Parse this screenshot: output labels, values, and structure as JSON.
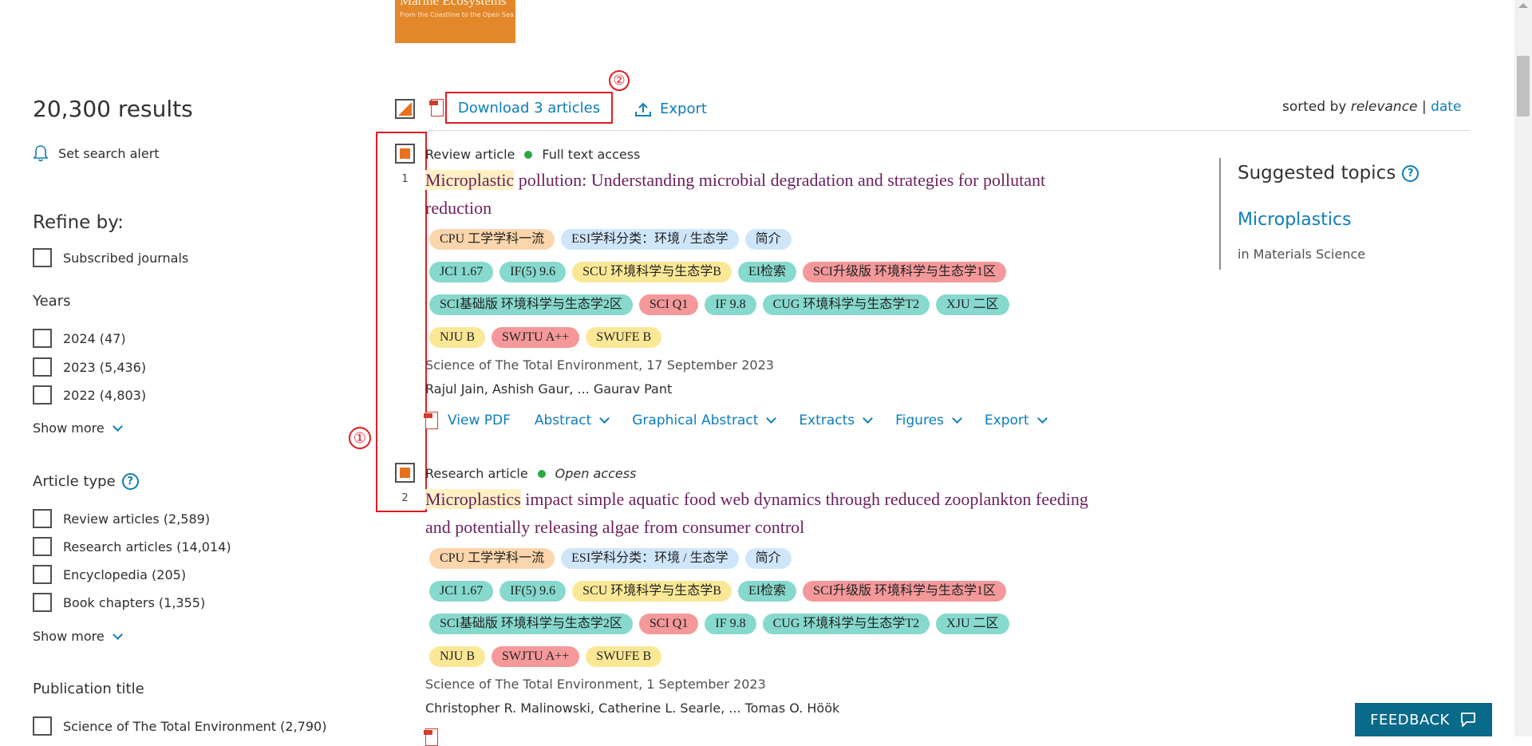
{
  "cover": {
    "title": "Marine Ecosystems",
    "subtitle": "From the Coastline to the Open Sea"
  },
  "sidebar": {
    "results_count": "20,300 results",
    "search_alert": "Set search alert",
    "refine_by": "Refine by:",
    "subscribed": "Subscribed journals",
    "years_title": "Years",
    "years": [
      "2024 (47)",
      "2023 (5,436)",
      "2022 (4,803)"
    ],
    "show_more": "Show more",
    "article_type_title": "Article type",
    "article_types": [
      "Review articles (2,589)",
      "Research articles (14,014)",
      "Encyclopedia (205)",
      "Book chapters (1,355)"
    ],
    "publication_title": "Publication title",
    "publications": [
      "Science of The Total Environment (2,790)"
    ]
  },
  "toolbar": {
    "download": "Download 3 articles",
    "export": "Export",
    "sorted_by": "sorted by",
    "relevance": "relevance",
    "separator": "|",
    "date": "date"
  },
  "annotations": {
    "one": "①",
    "two": "②"
  },
  "results": [
    {
      "num": "1",
      "type": "Review article",
      "access": "Full text access",
      "title_hl": "Microplastic",
      "title_line1": " pollution: Understanding microbial degradation and strategies for pollutant",
      "title_line2": "reduction",
      "source": "Science of The Total Environment, 17 September 2023",
      "authors": "Rajul Jain, Ashish Gaur, ... Gaurav Pant"
    },
    {
      "num": "2",
      "type": "Research article",
      "access": "Open access",
      "title_hl": "Microplastics",
      "title_line1": " impact simple aquatic food web dynamics through reduced zooplankton feeding",
      "title_line2": "and potentially releasing algae from consumer control",
      "source": "Science of The Total Environment, 1 September 2023",
      "authors": "Christopher R. Malinowski, Catherine L. Searle, ... Tomas O. Höök"
    }
  ],
  "tags": {
    "row1": [
      "CPU 工学学科一流",
      "ESI学科分类：环境 / 生态学",
      "简介"
    ],
    "row2": [
      "JCI 1.67",
      "IF(5) 9.6",
      "SCU 环境科学与生态学B",
      "EI检索",
      "SCI升级版 环境科学与生态学1区"
    ],
    "row3": [
      "SCI基础版 环境科学与生态学2区",
      "SCI Q1",
      "IF 9.8",
      "CUG 环境科学与生态学T2",
      "XJU 二区"
    ],
    "row4": [
      "NJU B",
      "SWJTU A++",
      "SWUFE B"
    ]
  },
  "actions": [
    "View PDF",
    "Abstract",
    "Graphical Abstract",
    "Extracts",
    "Figures",
    "Export"
  ],
  "topics": {
    "heading": "Suggested topics",
    "link": "Microplastics",
    "sub": "in Materials Science"
  },
  "feedback": "FEEDBACK",
  "colors": {
    "accent_orange": "#e9711c",
    "link_blue": "#0c7dbb",
    "title_purple": "#6b1f5e",
    "annotation_red": "#e11c22",
    "feedback_bg": "#0a6a8a"
  }
}
